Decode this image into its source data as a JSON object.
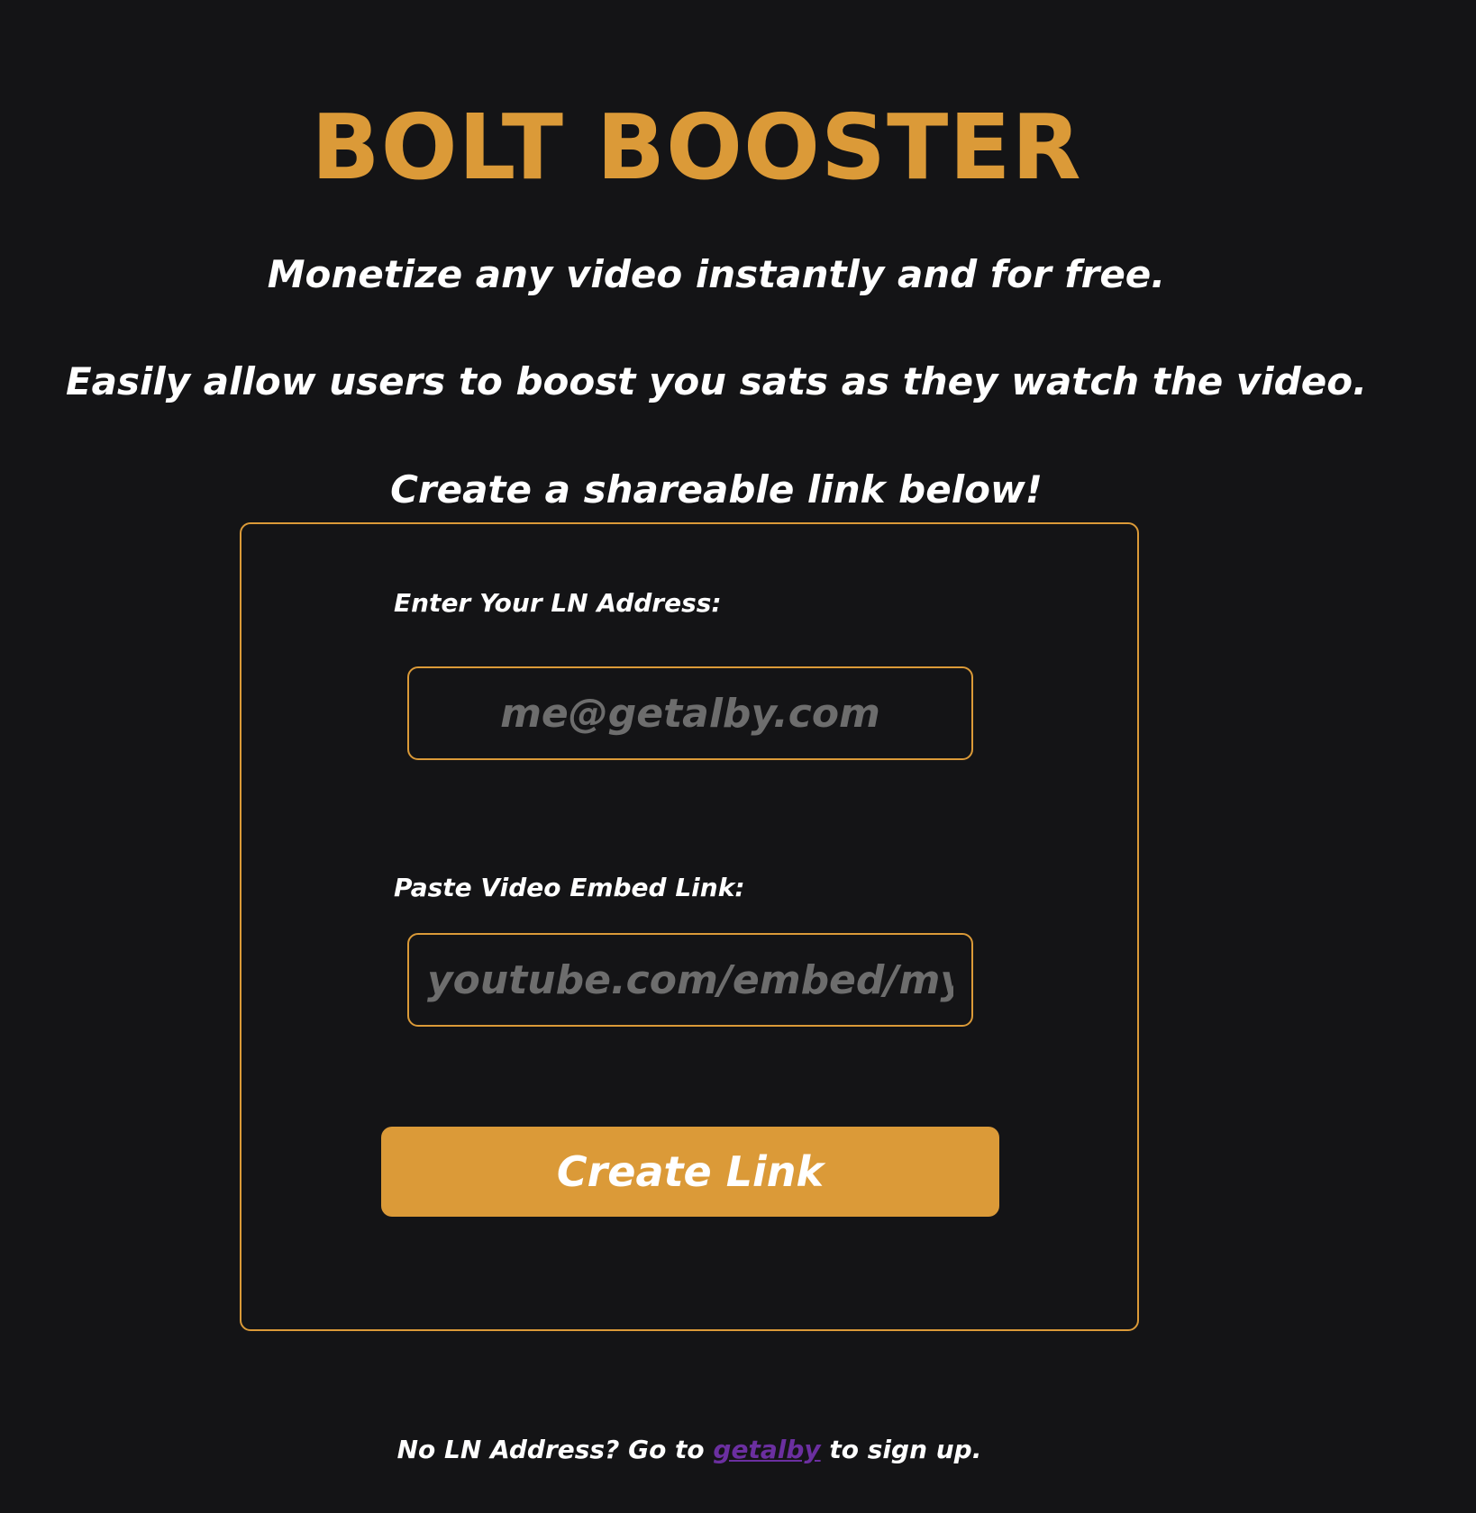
{
  "header": {
    "title": "BOLT BOOSTER"
  },
  "intro": {
    "line1": "Monetize any video instantly and for free.",
    "line2": "Easily allow users to boost you sats as they watch the video.",
    "line3": "Create a shareable link below!"
  },
  "form": {
    "ln_address_label": "Enter Your LN Address:",
    "ln_address_placeholder": "me@getalby.com",
    "ln_address_value": "",
    "embed_label": "Paste Video Embed Link:",
    "embed_placeholder": "youtube.com/embed/my",
    "embed_value": "",
    "submit_label": "Create Link"
  },
  "footer": {
    "prefix": "No LN Address? Go to ",
    "link_text": "getalby",
    "suffix": " to sign up."
  },
  "colors": {
    "background": "#141416",
    "accent": "#db9a38",
    "text": "#ffffff",
    "placeholder": "#6d6d6d",
    "link": "#6b2fa0"
  }
}
